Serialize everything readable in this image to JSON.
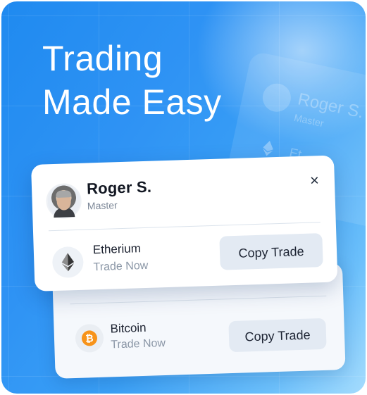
{
  "hero": {
    "line1": "Trading",
    "line2": "Made Easy"
  },
  "ghost_card": {
    "name": "Roger S.",
    "role": "Master",
    "coin_fragment": "Et"
  },
  "profile_card": {
    "name": "Roger S.",
    "role": "Master",
    "close_symbol": "×",
    "coin": {
      "name": "Etherium",
      "action": "Trade Now",
      "icon": "ethereum-icon"
    },
    "button_label": "Copy Trade"
  },
  "second_card": {
    "close_symbol": "×",
    "coin": {
      "name": "Bitcoin",
      "action": "Trade Now",
      "icon": "bitcoin-icon",
      "symbol": "₿"
    },
    "button_label": "Copy Trade"
  },
  "colors": {
    "background_start": "#1f8af0",
    "background_end": "#a5dcfd",
    "bitcoin": "#f7931a",
    "button_bg": "#e3eaf3"
  }
}
